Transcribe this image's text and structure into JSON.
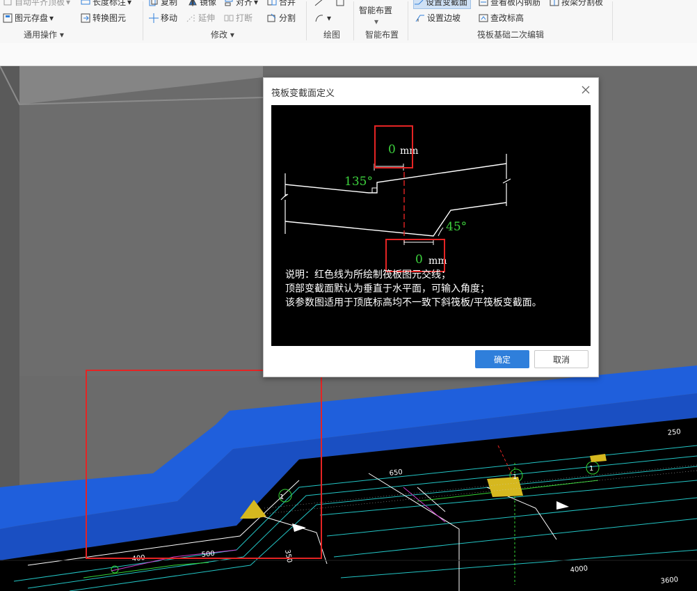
{
  "ribbon": {
    "groups": [
      {
        "label": "通用操作",
        "items": [
          "自动平齐顶板",
          "长度标注",
          "图元存盘",
          "转换图元"
        ]
      },
      {
        "label": "修改",
        "items": [
          "复制",
          "镜像",
          "对齐",
          "合并",
          "移动",
          "延伸",
          "打断",
          "分割"
        ]
      },
      {
        "label": "绘图",
        "items": []
      },
      {
        "label": "智能布置",
        "items": [
          "智能布置"
        ]
      },
      {
        "label": "筏板基础二次编辑",
        "items": [
          "设置变截面",
          "查看板内钢筋",
          "按梁分割板",
          "设置边坡",
          "查改标高"
        ]
      }
    ]
  },
  "dialog": {
    "title": "筏板变截面定义",
    "top_value": "0",
    "bottom_value": "0",
    "unit": "mm",
    "angle_top": "135°",
    "angle_bottom": "45°",
    "notes": [
      "说明：红色线为所绘制筏板图元交线；",
      "顶部变截面默认为垂直于水平面，可输入角度；",
      "该参数图适用于顶底标高均不一致下斜筏板/平筏板变截面。"
    ],
    "ok_label": "确定",
    "cancel_label": "取消"
  },
  "cad": {
    "labels": [
      "1",
      "1",
      "1",
      "4000",
      "3600",
      "250",
      "650",
      "500",
      "400",
      "350",
      "1",
      "1"
    ]
  },
  "colors": {
    "accent": "#2f7fdb",
    "highlight": "#e52424",
    "raft": "#1f5fdc",
    "gray_wall": "#6d6d6d"
  }
}
